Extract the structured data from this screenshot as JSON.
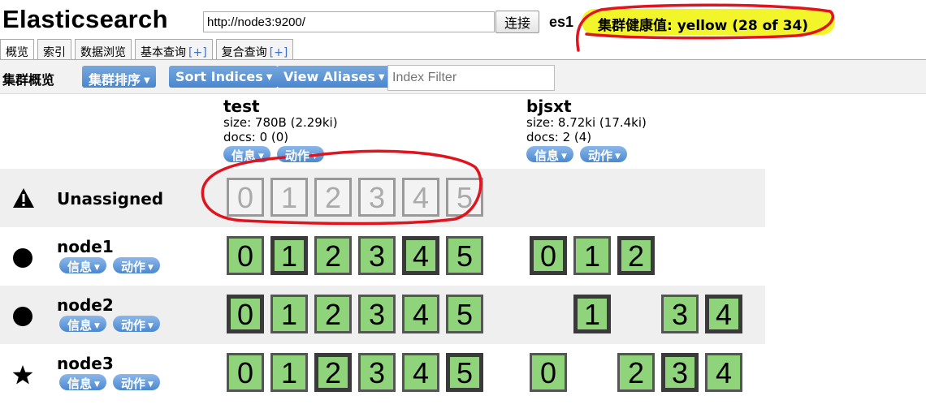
{
  "header": {
    "app_title": "Elasticsearch",
    "url": "http://node3:9200/",
    "connect_label": "连接",
    "cluster_name": "es1",
    "health_text": "集群健康值: yellow (28 of 34)",
    "health_color": "#f2f52a"
  },
  "tabs": [
    {
      "label": "概览",
      "active": true
    },
    {
      "label": "索引",
      "active": false
    },
    {
      "label": "数据浏览",
      "active": false
    },
    {
      "label": "基本查询",
      "plus": "[+]",
      "active": false
    },
    {
      "label": "复合查询",
      "plus": "[+]",
      "active": false
    }
  ],
  "toolbar": {
    "title": "集群概览",
    "sort_cluster_label": "集群排序",
    "sort_indices_label": "Sort Indices",
    "view_aliases_label": "View Aliases",
    "index_filter_placeholder": "Index Filter",
    "caret": "▼",
    "button_color": "#4a86ce"
  },
  "pill_labels": {
    "info": "信息",
    "action": "动作"
  },
  "indices": [
    {
      "name": "test",
      "size": "size: 780B (2.29ki)",
      "docs": "docs: 0 (0)"
    },
    {
      "name": "bjsxt",
      "size": "size: 8.72ki (17.4ki)",
      "docs": "docs: 2 (4)"
    }
  ],
  "nodes": [
    {
      "name": "Unassigned",
      "icon": "warning-icon",
      "shaded": true,
      "has_pills": false,
      "shards": [
        {
          "index": "test",
          "n": "0",
          "state": "unassigned"
        },
        {
          "index": "test",
          "n": "1",
          "state": "unassigned"
        },
        {
          "index": "test",
          "n": "2",
          "state": "unassigned"
        },
        {
          "index": "test",
          "n": "3",
          "state": "unassigned"
        },
        {
          "index": "test",
          "n": "4",
          "state": "unassigned"
        },
        {
          "index": "test",
          "n": "5",
          "state": "unassigned"
        }
      ]
    },
    {
      "name": "node1",
      "icon": "circle-icon",
      "shaded": false,
      "has_pills": true,
      "shards": [
        {
          "index": "test",
          "n": "0",
          "state": "replica"
        },
        {
          "index": "test",
          "n": "1",
          "state": "primary"
        },
        {
          "index": "test",
          "n": "2",
          "state": "replica"
        },
        {
          "index": "test",
          "n": "3",
          "state": "replica"
        },
        {
          "index": "test",
          "n": "4",
          "state": "primary"
        },
        {
          "index": "test",
          "n": "5",
          "state": "replica"
        },
        {
          "index": "bjsxt",
          "n": "0",
          "state": "primary"
        },
        {
          "index": "bjsxt",
          "n": "1",
          "state": "replica"
        },
        {
          "index": "bjsxt",
          "n": "2",
          "state": "primary"
        }
      ]
    },
    {
      "name": "node2",
      "icon": "circle-icon",
      "shaded": true,
      "has_pills": true,
      "shards": [
        {
          "index": "test",
          "n": "0",
          "state": "primary"
        },
        {
          "index": "test",
          "n": "1",
          "state": "replica"
        },
        {
          "index": "test",
          "n": "2",
          "state": "replica"
        },
        {
          "index": "test",
          "n": "3",
          "state": "replica"
        },
        {
          "index": "test",
          "n": "4",
          "state": "replica"
        },
        {
          "index": "test",
          "n": "5",
          "state": "replica"
        },
        {
          "index": "bjsxt",
          "n": "1",
          "state": "primary"
        },
        {
          "index": "bjsxt",
          "n": "3",
          "state": "replica"
        },
        {
          "index": "bjsxt",
          "n": "4",
          "state": "primary"
        }
      ]
    },
    {
      "name": "node3",
      "icon": "star-icon",
      "shaded": false,
      "has_pills": true,
      "shards": [
        {
          "index": "test",
          "n": "0",
          "state": "replica"
        },
        {
          "index": "test",
          "n": "1",
          "state": "replica"
        },
        {
          "index": "test",
          "n": "2",
          "state": "primary"
        },
        {
          "index": "test",
          "n": "3",
          "state": "replica"
        },
        {
          "index": "test",
          "n": "4",
          "state": "replica"
        },
        {
          "index": "test",
          "n": "5",
          "state": "primary"
        },
        {
          "index": "bjsxt",
          "n": "0",
          "state": "replica"
        },
        {
          "index": "bjsxt",
          "n": "2",
          "state": "replica"
        },
        {
          "index": "bjsxt",
          "n": "3",
          "state": "primary"
        },
        {
          "index": "bjsxt",
          "n": "4",
          "state": "replica"
        }
      ]
    }
  ],
  "colors": {
    "shard_started": "#8fd37a",
    "row_shade": "#efefef",
    "annotation": "#e0141e"
  }
}
